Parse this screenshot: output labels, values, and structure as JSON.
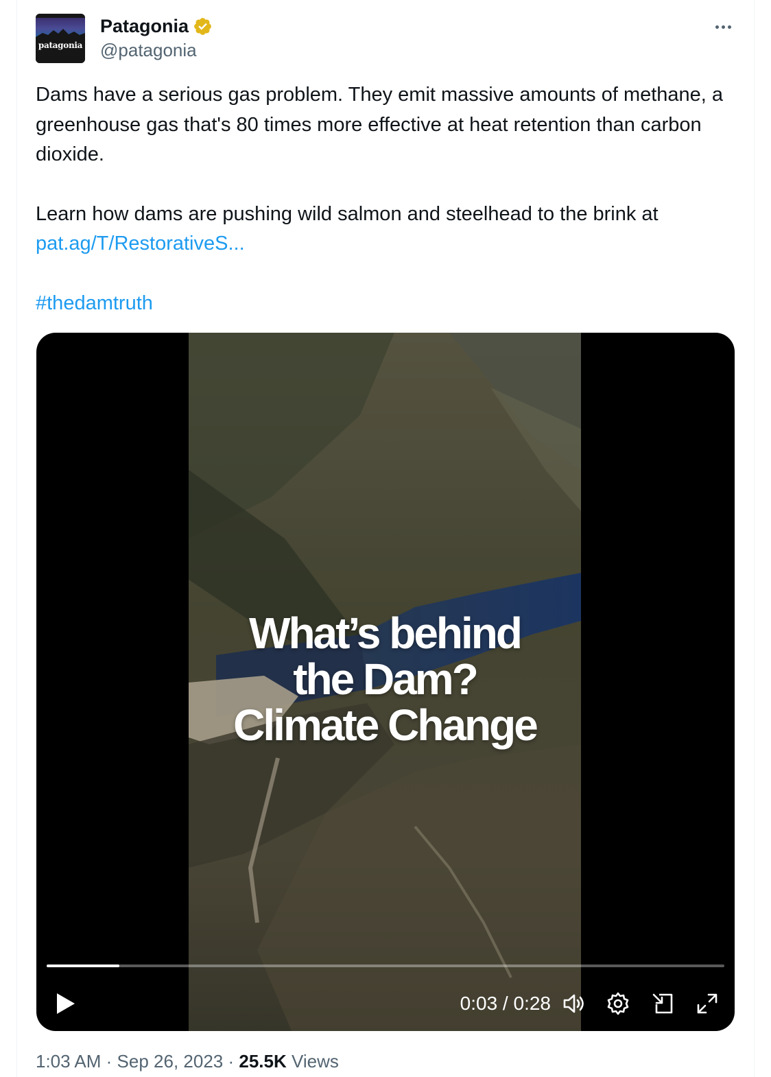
{
  "author": {
    "display_name": "Patagonia",
    "handle": "@patagonia",
    "avatar_text": "patagonia",
    "verified_color": "#e2b719"
  },
  "tweet": {
    "paragraph1": "Dams have a serious gas problem. They emit massive amounts of methane, a greenhouse gas that's 80 times more effective at heat retention than carbon dioxide.",
    "paragraph2": "Learn how dams are pushing wild salmon and steelhead to the brink at",
    "link": "pat.ag/T/RestorativeS...",
    "hashtag": "#thedamtruth",
    "link_color": "#1d9bf0"
  },
  "video": {
    "overlay_line1": "What’s behind",
    "overlay_line2": "the Dam?",
    "overlay_line3": "Climate Change",
    "time_display": "0:03 / 0:28",
    "progress_fraction": 0.107
  },
  "footer": {
    "time": "1:03 AM",
    "separator": "·",
    "date": "Sep 26, 2023",
    "views_count": "25.5K",
    "views_label": "Views"
  },
  "icons": {
    "more": "more-options-icon",
    "verified": "verified-badge-icon",
    "play": "play-icon",
    "volume": "volume-icon",
    "settings": "gear-icon",
    "minimize": "dock-video-icon",
    "fullscreen": "fullscreen-icon"
  }
}
